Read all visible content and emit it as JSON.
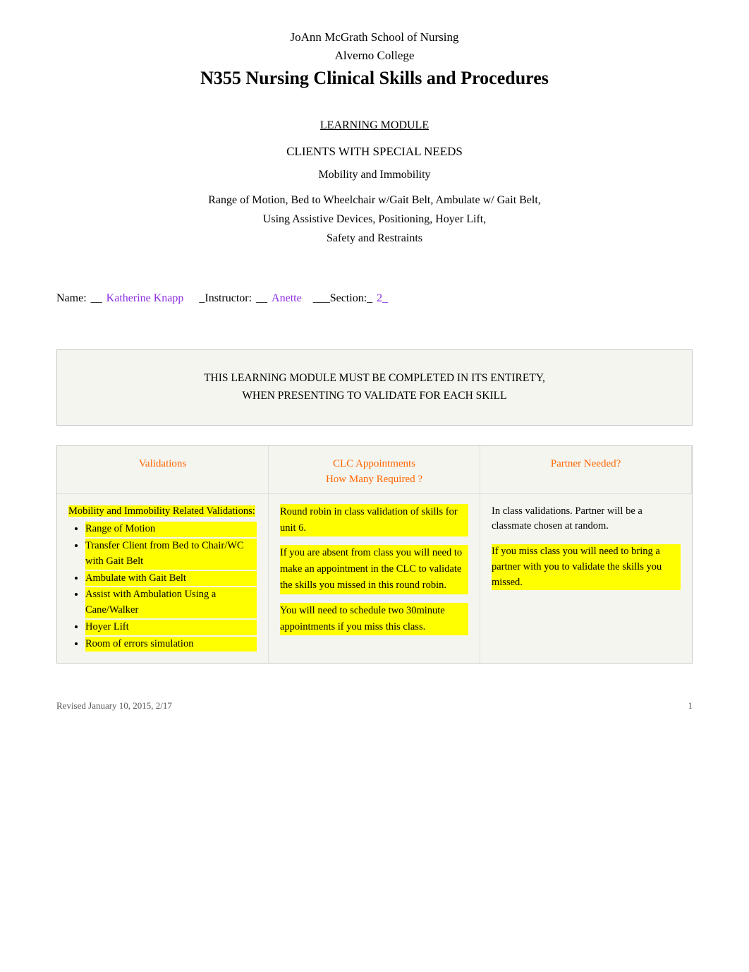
{
  "header": {
    "line1": "JoAnn McGrath School of Nursing",
    "line2": "Alverno College",
    "line3": "N355 Nursing Clinical Skills and Procedures"
  },
  "learning_module_label": "LEARNING MODULE",
  "module_title": "CLIENTS WITH SPECIAL NEEDS",
  "subtitle": "Mobility and Immobility",
  "skills_line1": "Range of Motion, Bed to Wheelchair w/Gait Belt, Ambulate w/ Gait Belt,",
  "skills_line2": "Using Assistive Devices, Positioning, Hoyer Lift,",
  "skills_line3": "Safety and Restraints",
  "name_label": "Name:",
  "name_underline": "__",
  "name_value": "Katherine Knapp",
  "instructor_label": "_Instructor:",
  "instructor_underline": "__",
  "instructor_value": "Anette",
  "section_label": "___Section:_",
  "section_value": "2_",
  "notice": {
    "line1": "THIS LEARNING MODULE MUST BE COMPLETED    IN ITS ENTIRETY,",
    "line2": "WHEN PRESENTING TO VALIDATE FOR EACH SKILL"
  },
  "table": {
    "col1_header": "Validations",
    "col2_header": "CLC Appointments\nHow Many Required   ?",
    "col3_header": "Partner Needed?",
    "col1_title": "Mobility and Immobility Related Validations:",
    "col1_items": [
      "Range of Motion",
      "Transfer Client from Bed to Chair/WC with Gait Belt",
      "Ambulate with Gait Belt",
      "Assist with Ambulation Using a Cane/Walker",
      "Hoyer Lift",
      "Room of errors simulation"
    ],
    "col2_para1": "Round robin in class validation of skills for unit 6.",
    "col2_para2": "If you are absent from class you will need to make an appointment in the CLC to validate the skills you missed in this round robin.",
    "col2_para3": "You will need to schedule two 30minute appointments if you miss this class.",
    "col3_para1": "In class validations. Partner will be a classmate chosen at random.",
    "col3_para2": "If you miss class you will need to bring a partner with you to validate the skills you missed."
  },
  "footer": {
    "left": "Revised January 10, 2015, 2/17",
    "right": "1"
  }
}
